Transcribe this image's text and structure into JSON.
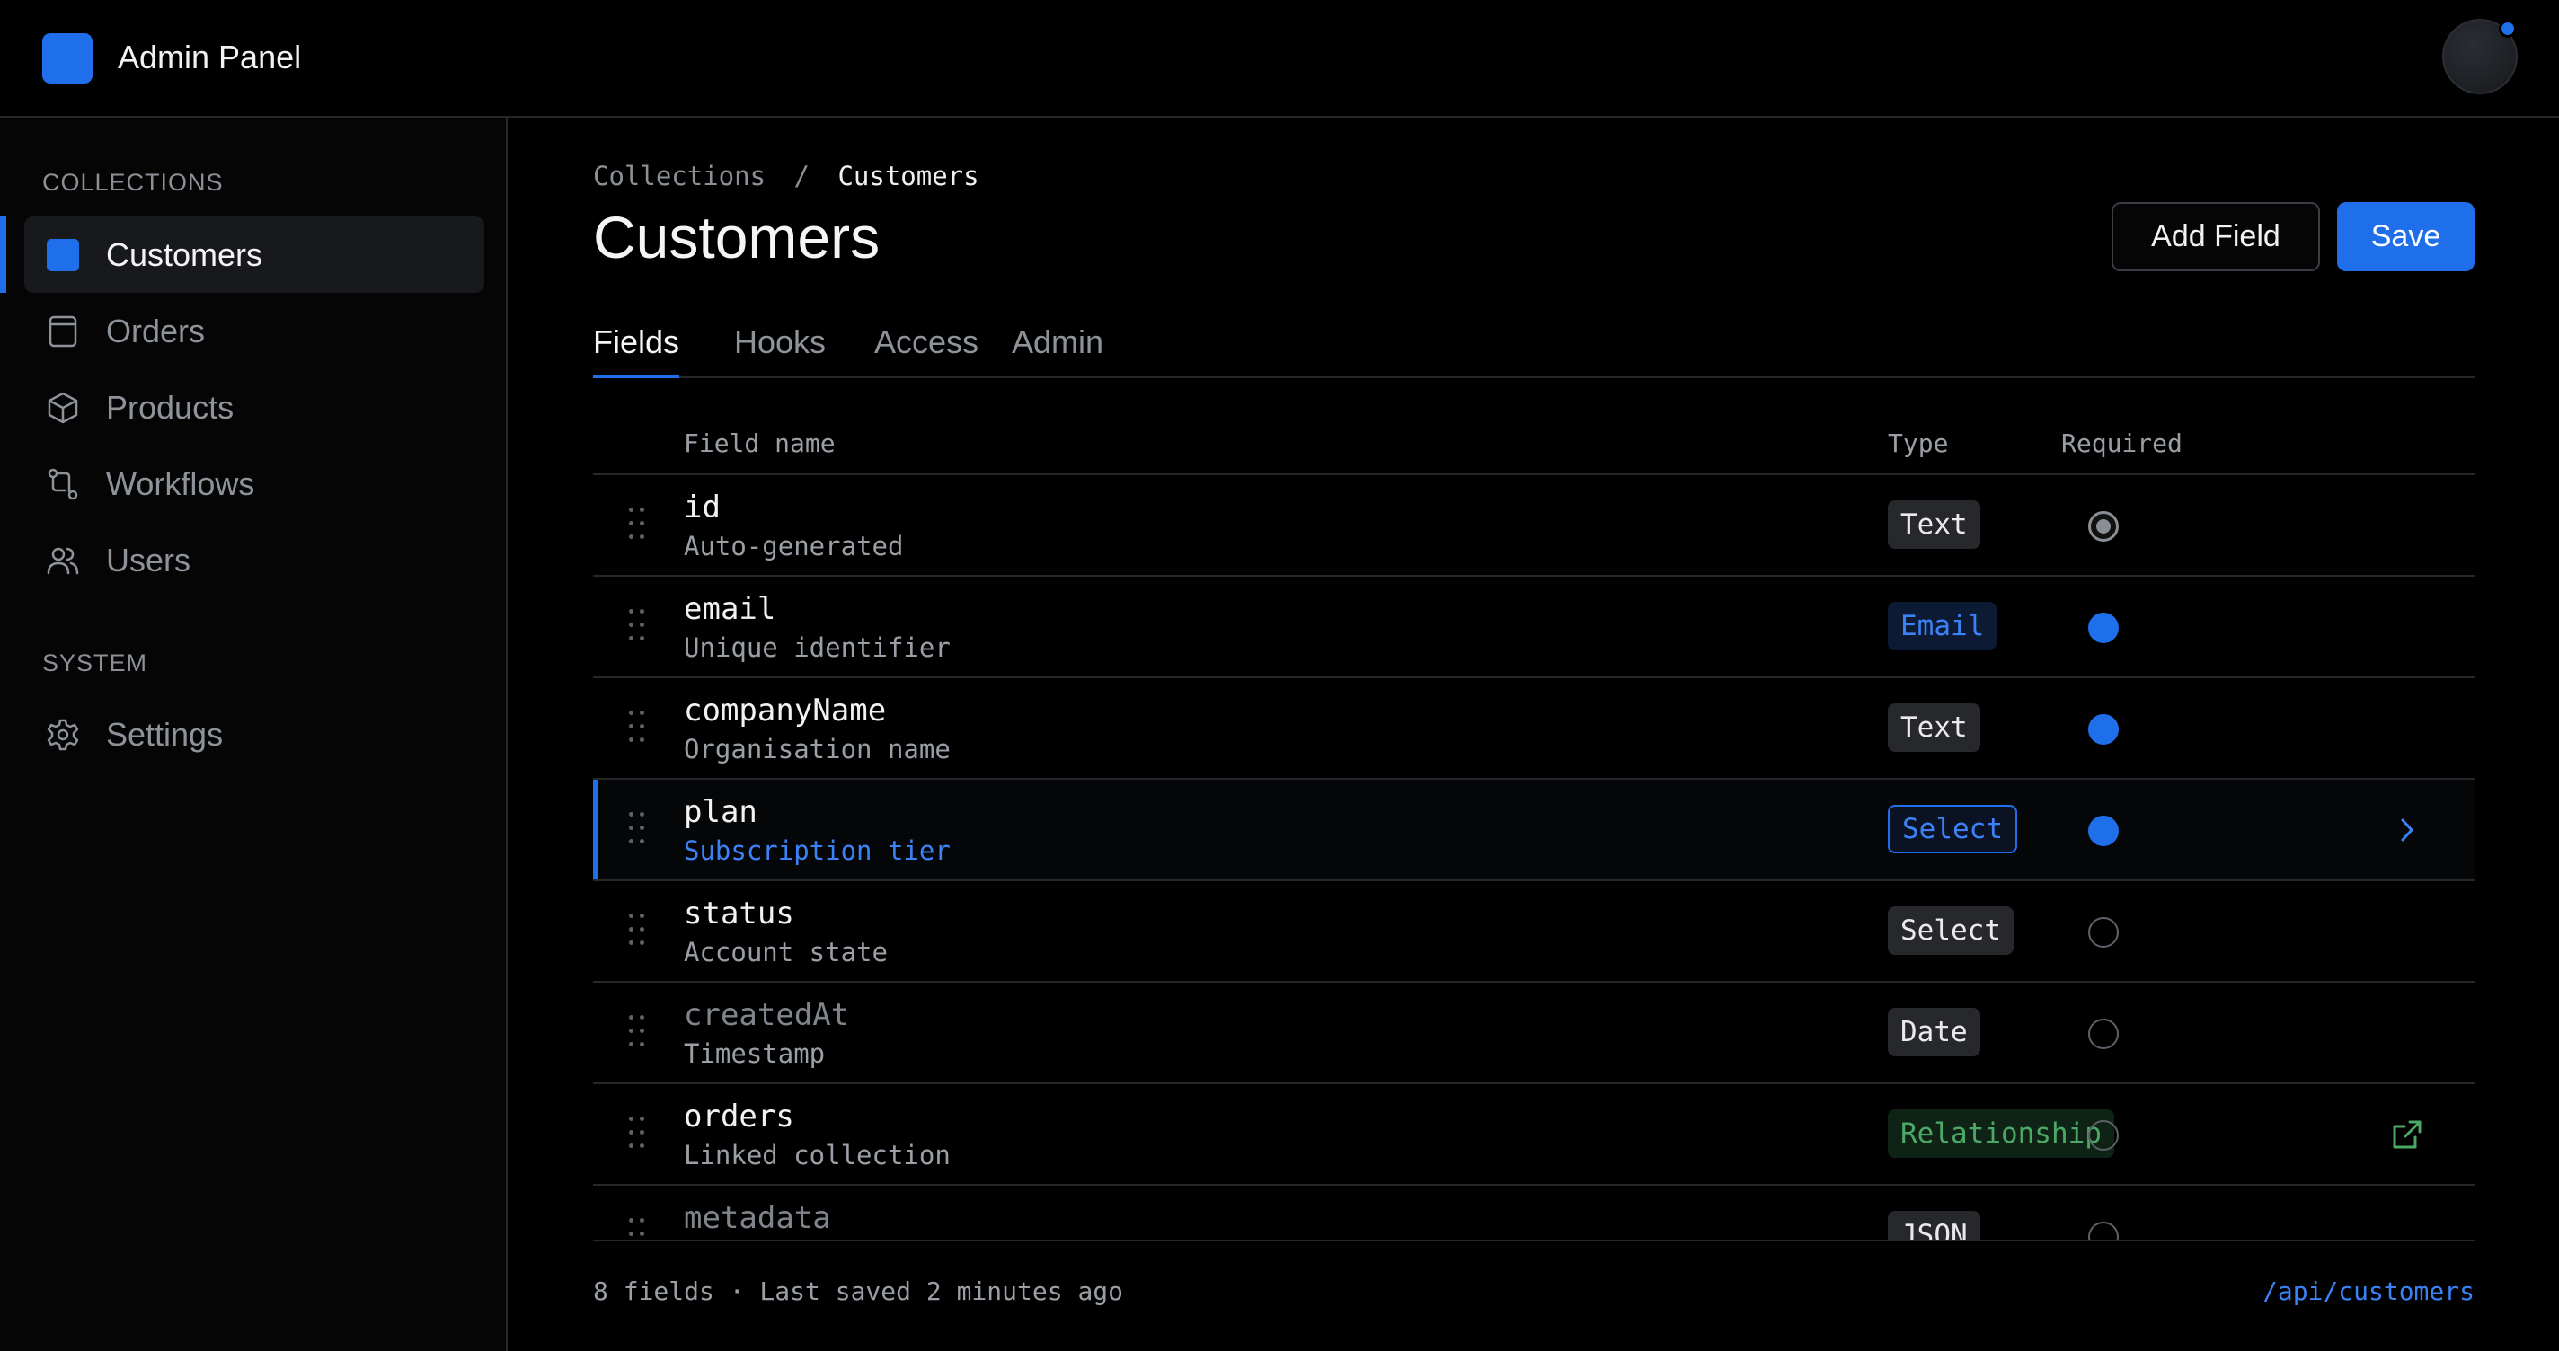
{
  "app": {
    "title": "Admin Panel"
  },
  "sidebar": {
    "collections_label": "COLLECTIONS",
    "system_label": "SYSTEM",
    "items": [
      {
        "label": "Customers",
        "icon": "square-filled-icon",
        "active": true
      },
      {
        "label": "Orders",
        "icon": "document-icon"
      },
      {
        "label": "Products",
        "icon": "cube-icon"
      },
      {
        "label": "Workflows",
        "icon": "workflow-icon"
      },
      {
        "label": "Users",
        "icon": "users-icon"
      }
    ],
    "system_items": [
      {
        "label": "Settings",
        "icon": "gear-icon"
      }
    ]
  },
  "breadcrumb": {
    "parent": "Collections",
    "separator": "/",
    "current": "Customers"
  },
  "page": {
    "title": "Customers"
  },
  "actions": {
    "add_field": "Add Field",
    "save": "Save"
  },
  "tabs": [
    "Fields",
    "Hooks",
    "Access",
    "Admin"
  ],
  "table": {
    "headers": {
      "name": "Field name",
      "type": "Type",
      "required": "Required"
    },
    "rows": [
      {
        "name": "id",
        "desc": "Auto-generated",
        "type": "Text",
        "required": "locked"
      },
      {
        "name": "email",
        "desc": "Unique identifier",
        "type": "Email",
        "required": "yes"
      },
      {
        "name": "companyName",
        "desc": "Organisation name",
        "type": "Text",
        "required": "yes"
      },
      {
        "name": "plan",
        "desc": "Subscription tier",
        "type": "Select",
        "required": "yes",
        "selected": true
      },
      {
        "name": "status",
        "desc": "Account state",
        "type": "Select",
        "required": "no"
      },
      {
        "name": "createdAt",
        "desc": "Timestamp",
        "type": "Date",
        "required": "no"
      },
      {
        "name": "orders",
        "desc": "Linked collection",
        "type": "Relationship",
        "required": "no"
      },
      {
        "name": "metadata",
        "desc": "",
        "type": "JSON",
        "required": "no"
      }
    ]
  },
  "footer": {
    "summary": "8 fields · Last saved 2 minutes ago",
    "endpoint": "/api/customers"
  },
  "colors": {
    "accent": "#1f6fea",
    "background": "#000000",
    "border": "#26272b",
    "relationship": "#4ca865"
  }
}
